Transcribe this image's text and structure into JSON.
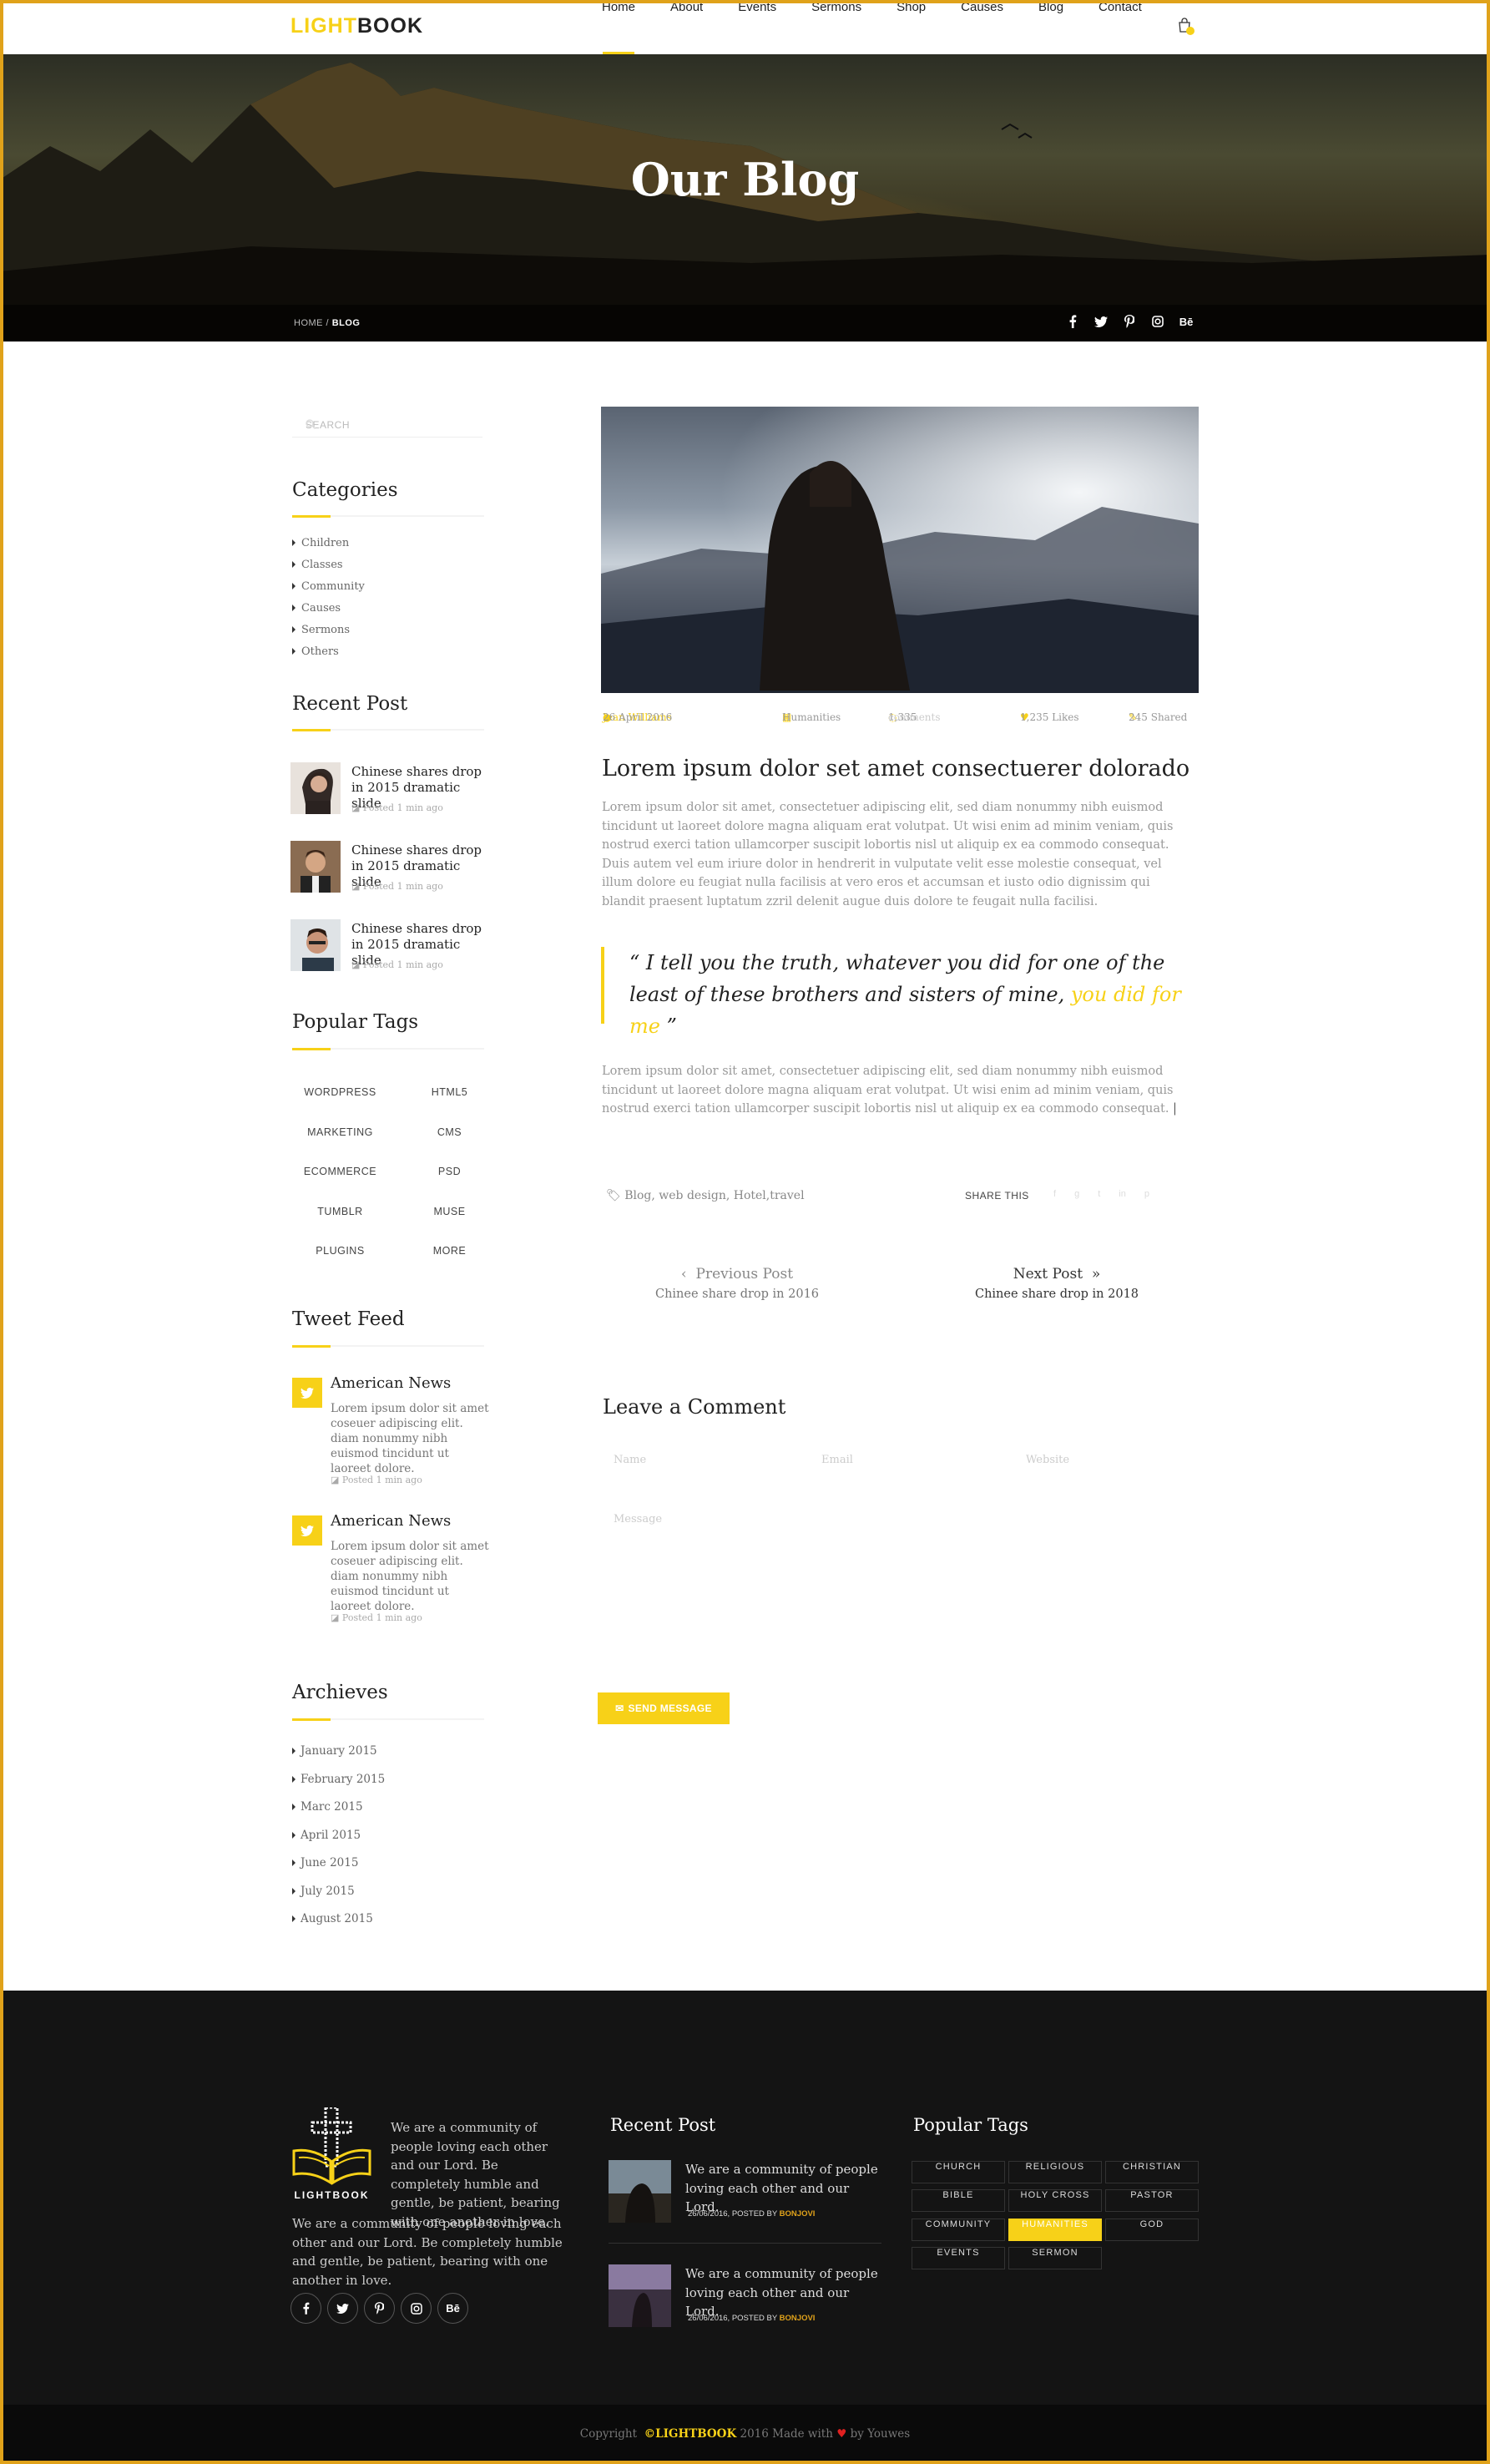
{
  "header": {
    "logo_part1": "LIGHT",
    "logo_part2": "BOOK",
    "nav": [
      "Home",
      "About",
      "Events",
      "Sermons",
      "Shop",
      "Causes",
      "Blog",
      "Contact"
    ],
    "cart_count": "0"
  },
  "hero": {
    "title": "Our Blog",
    "breadcrumb_home": "HOME /",
    "breadcrumb_current": "BLOG",
    "social_icons": [
      "facebook-icon",
      "twitter-icon",
      "pinterest-icon",
      "instagram-icon",
      "behance-icon"
    ]
  },
  "sidebar": {
    "search_placeholder": "SEARCH",
    "categories_title": "Categories",
    "categories": [
      "Children",
      "Classes",
      "Community",
      "Causes",
      "Sermons",
      "Others"
    ],
    "recent_title": "Recent Post",
    "recent_posts": [
      {
        "title": "Chinese shares drop in 2015 dramatic slide",
        "meta": "Posted 1 min ago"
      },
      {
        "title": "Chinese shares drop in 2015 dramatic slide",
        "meta": "Posted 1 min ago"
      },
      {
        "title": "Chinese shares drop in 2015 dramatic slide",
        "meta": "Posted 1 min ago"
      }
    ],
    "tags_title": "Popular Tags",
    "tags": [
      "WORDPRESS",
      "HTML5",
      "MARKETING",
      "CMS",
      "ECOMMERCE",
      "PSD",
      "TUMBLR",
      "MUSE",
      "PLUGINS",
      "MORE"
    ],
    "tweet_title": "Tweet Feed",
    "tweets": [
      {
        "name": "American News",
        "text": "Lorem ipsum dolor sit amet coseuer adipiscing elit. diam nonummy nibh euismod tincidunt ut laoreet dolore.",
        "meta": "Posted 1 min ago"
      },
      {
        "name": "American News",
        "text": "Lorem ipsum dolor sit amet coseuer adipiscing elit. diam nonummy nibh euismod tincidunt ut laoreet dolore.",
        "meta": "Posted 1 min ago"
      }
    ],
    "archives_title": "Archieves",
    "archives": [
      "January 2015",
      "February 2015",
      "Marc 2015",
      "April 2015",
      "June 2015",
      "July 2015",
      "August 2015"
    ]
  },
  "post": {
    "meta": {
      "author": "Jean Williams",
      "date": "26 April 2016",
      "category": "Humanities",
      "comments_count": "1,335",
      "comments_label": "comments",
      "likes": "1,235 Likes",
      "shared": "245 Shared"
    },
    "title": "Lorem ipsum dolor set amet consectuerer dolorado",
    "para1": "Lorem ipsum dolor sit amet, consectetuer adipiscing elit, sed diam nonummy nibh euismod tincidunt ut laoreet dolore magna aliquam erat volutpat. Ut wisi enim ad minim veniam, quis nostrud exerci tation ullamcorper suscipit lobortis nisl ut aliquip ex ea commodo consequat. Duis autem vel eum iriure dolor in hendrerit in vulputate velit esse molestie consequat, vel illum dolore eu feugiat nulla facilisis at vero eros et accumsan et iusto odio dignissim qui blandit praesent luptatum zzril delenit augue duis dolore te feugait nulla facilisi.",
    "quote_main": "“ I tell you the truth, whatever you did for one of the least of these brothers and sisters of mine,",
    "quote_highlight": "you did for me",
    "quote_end": "”",
    "para2": "Lorem ipsum dolor sit amet, consectetuer adipiscing elit, sed diam nonummy nibh euismod tincidunt ut laoreet dolore magna aliquam erat volutpat. Ut wisi enim ad minim veniam, quis nostrud exerci tation ullamcorper suscipit lobortis nisl ut aliquip ex ea commodo consequat.",
    "tags": "Blog, web design, Hotel,travel",
    "share_label": "SHARE THIS",
    "prev_label": "Previous Post",
    "prev_title": "Chinee share drop in 2016",
    "next_label": "Next Post",
    "next_title": "Chinee share drop in 2018"
  },
  "comment": {
    "title": "Leave a Comment",
    "name_placeholder": "Name",
    "email_placeholder": "Email",
    "website_placeholder": "Website",
    "message_placeholder": "Message",
    "send_label": "SEND MESSAGE"
  },
  "footer": {
    "logo_text": "LIGHTBOOK",
    "about_short": "We are a community of people loving each other and our Lord. Be completely humble and gentle, be patient, bearing with one another in love.",
    "about_long": "We are a community of people loving each other and our Lord. Be completely humble and gentle, be patient, bearing with one another in love.",
    "recent_title": "Recent Post",
    "recent_posts": [
      {
        "text": "We are a community of people loving each other and our Lord.",
        "date": "26/06/2016, POSTED BY",
        "author": "BONJOVI"
      },
      {
        "text": "We are a community of people loving each other and our Lord.",
        "date": "26/06/2016, POSTED BY",
        "author": "BONJOVI"
      }
    ],
    "tags_title": "Popular Tags",
    "tags": [
      "CHURCH",
      "RELIGIOUS",
      "CHRISTIAN",
      "BIBLE",
      "HOLY CROSS",
      "PASTOR",
      "COMMUNITY",
      "HUMANITIES",
      "GOD",
      "EVENTS",
      "SERMON"
    ],
    "active_tag": "HUMANITIES"
  },
  "copyright": {
    "prefix": "Copyright",
    "brand": "©LIGHTBOOK",
    "middle": "2016 Made with",
    "heart": "♥",
    "suffix": "by Youwes"
  },
  "colors": {
    "accent": "#f7d118",
    "frame": "#e0a21a",
    "footer_bg": "#141414"
  }
}
